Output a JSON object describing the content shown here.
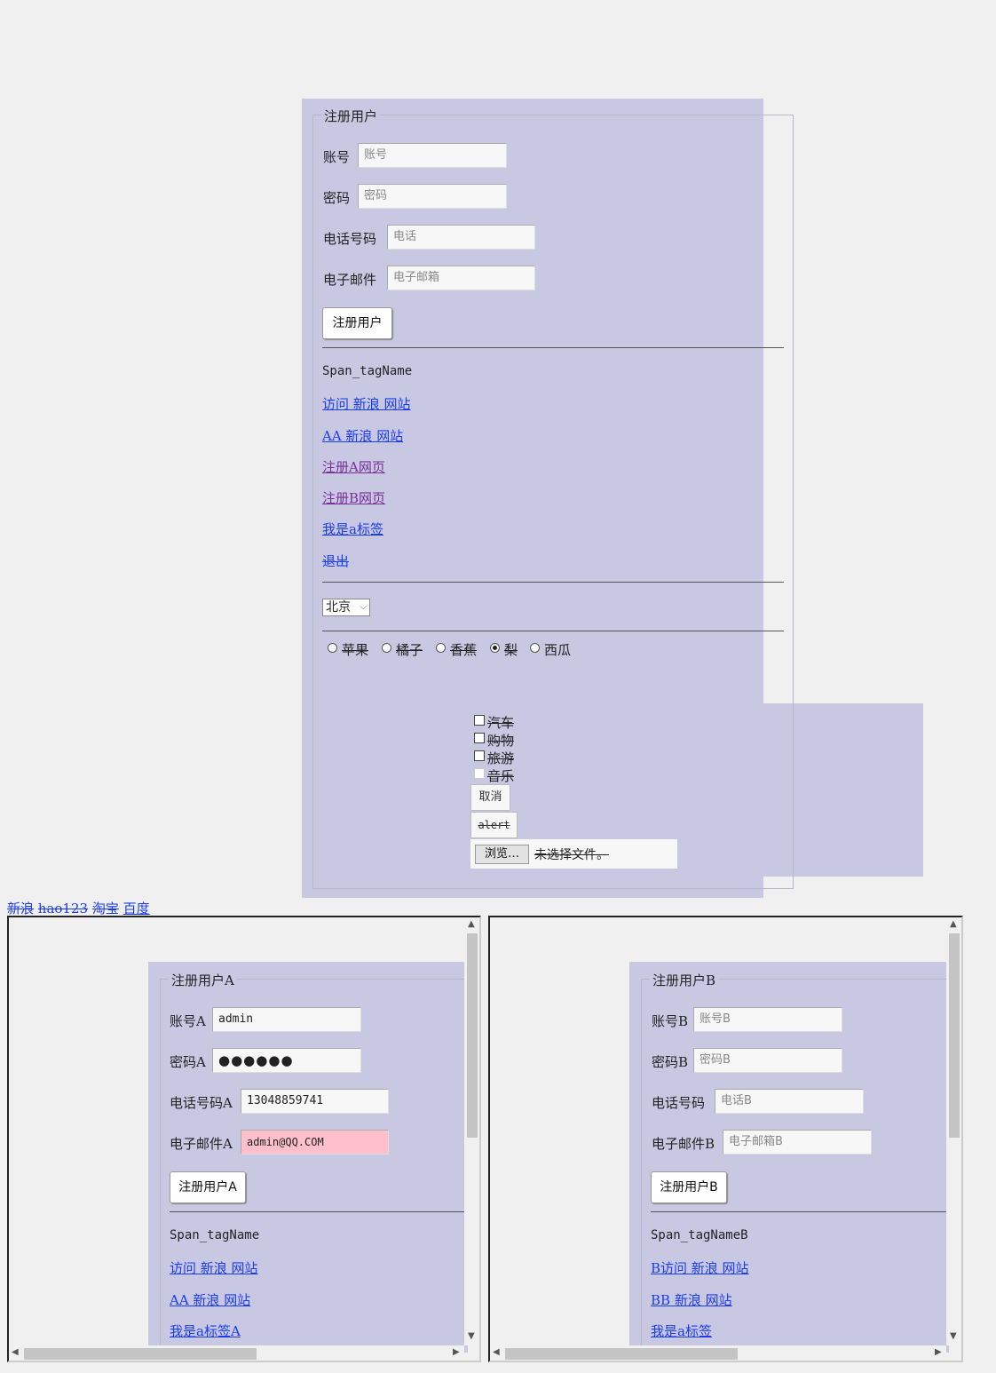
{
  "main_form": {
    "legend": "注册用户",
    "fields": [
      {
        "label": "账号",
        "placeholder": "账号"
      },
      {
        "label": "密码",
        "placeholder": "密码"
      },
      {
        "label": "电话号码",
        "placeholder": "电话"
      },
      {
        "label": "电子邮件",
        "placeholder": "电子邮箱"
      }
    ],
    "submit_label": "注册用户",
    "span_text": "Span_tagName",
    "links": [
      {
        "text": "访问 新浪 网站"
      },
      {
        "text": "AA 新浪 网站"
      },
      {
        "text": "注册A网页"
      },
      {
        "text": "注册B网页"
      },
      {
        "text": "我是a标签"
      },
      {
        "text": "退出"
      }
    ],
    "city_select": {
      "selected": "北京"
    },
    "fruits": [
      {
        "label": "苹果",
        "checked": false
      },
      {
        "label": "橘子",
        "checked": false
      },
      {
        "label": "香蕉",
        "checked": false
      },
      {
        "label": "梨",
        "checked": true
      },
      {
        "label": "西瓜",
        "checked": false
      }
    ],
    "hobbies": [
      {
        "label": "汽车"
      },
      {
        "label": "购物"
      },
      {
        "label": "旅游"
      },
      {
        "label": "音乐"
      }
    ],
    "cancel_label": "取消",
    "alert_label": "alert",
    "file": {
      "browse_label": "浏览…",
      "status": "未选择文件。"
    }
  },
  "top_links": [
    "新浪",
    "hao123",
    "淘宝",
    "百度"
  ],
  "frame_a": {
    "legend": "注册用户A",
    "fields": [
      {
        "label": "账号A",
        "value": "admin"
      },
      {
        "label": "密码A",
        "value": "●●●●●●"
      },
      {
        "label": "电话号码A",
        "value": "13048859741"
      },
      {
        "label": "电子邮件A",
        "value": "admin@QQ.COM"
      }
    ],
    "submit_label": "注册用户A",
    "span_text": "Span_tagName",
    "links": [
      {
        "text": "访问 新浪 网站"
      },
      {
        "text": "AA 新浪 网站"
      },
      {
        "text": "我是a标签A"
      }
    ]
  },
  "frame_b": {
    "legend": "注册用户B",
    "fields": [
      {
        "label": "账号B",
        "placeholder": "账号B"
      },
      {
        "label": "密码B",
        "placeholder": "密码B"
      },
      {
        "label": "电话号码",
        "placeholder": "电话B"
      },
      {
        "label": "电子邮件B",
        "placeholder": "电子邮箱B"
      }
    ],
    "submit_label": "注册用户B",
    "span_text": "Span_tagNameB",
    "links": [
      {
        "text": "B访问 新浪 网站"
      },
      {
        "text": "BB 新浪 网站"
      },
      {
        "text": "我是a标签"
      }
    ]
  },
  "colors": {
    "panel": "#c8c8e2",
    "link": "#1a3cf0",
    "visited": "#7a2e9a",
    "email_highlight": "#ffc0cb"
  }
}
